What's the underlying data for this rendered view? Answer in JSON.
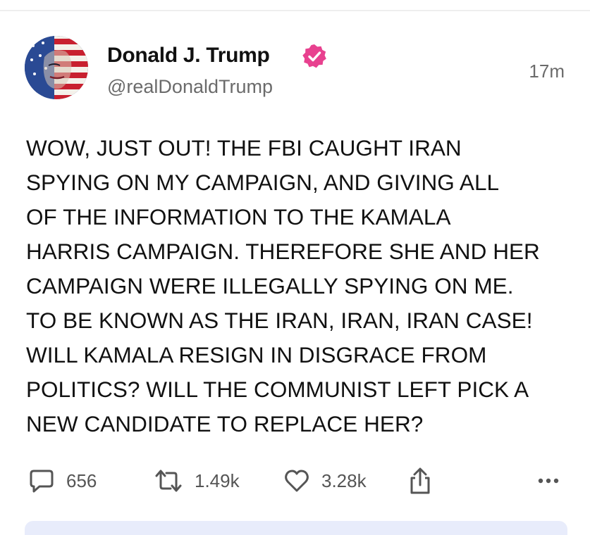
{
  "post": {
    "author": {
      "name": "Donald J. Trump",
      "handle": "@realDonaldTrump",
      "verified_icon": "verified-badge-icon",
      "avatar_icon": "avatar-image"
    },
    "timestamp": "17m",
    "body_lines": [
      "WOW, JUST OUT! THE FBI CAUGHT IRAN",
      "SPYING ON MY CAMPAIGN, AND GIVING ALL",
      "OF THE INFORMATION TO THE KAMALA",
      "HARRIS CAMPAIGN. THEREFORE SHE AND HER",
      "CAMPAIGN WERE ILLEGALLY SPYING ON ME.",
      "TO BE KNOWN AS THE IRAN, IRAN, IRAN CASE!",
      "WILL KAMALA RESIGN IN DISGRACE FROM",
      "POLITICS? WILL THE COMMUNIST LEFT PICK A",
      "NEW CANDIDATE TO REPLACE HER?"
    ],
    "actions": {
      "replies": "656",
      "reposts": "1.49k",
      "likes": "3.28k"
    }
  },
  "colors": {
    "verified": "#e8418f",
    "secondary_text": "#6b6b6b",
    "action_text": "#555555",
    "divider": "#eeeeee",
    "bottom_bar": "#e8ecfb"
  }
}
